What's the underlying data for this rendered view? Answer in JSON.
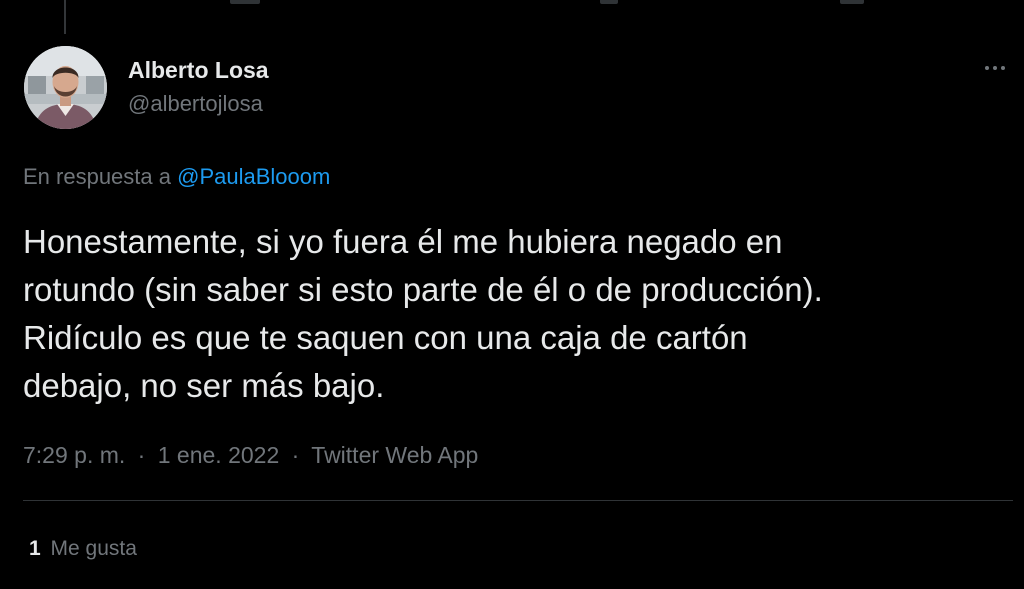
{
  "colors": {
    "background": "#000000",
    "primary_text": "#e7e9ea",
    "secondary_text": "#71767b",
    "link": "#1d9bf0",
    "divider": "#2f3336"
  },
  "tweet": {
    "author": {
      "display_name": "Alberto Losa",
      "handle": "@albertojlosa",
      "avatar_icon": "user-avatar-photo"
    },
    "more_icon": "more-horizontal-icon",
    "reply_context": {
      "prefix": "En respuesta a",
      "mention": "@PaulaBlooom"
    },
    "text": "Honestamente, si yo fuera él me hubiera negado en\nrotundo (sin saber si esto parte de él o de producción).\nRidículo es que te saquen con una caja de cartón\ndebajo, no ser más bajo.",
    "time": "7:29 p. m.",
    "separator": "·",
    "date": "1 ene. 2022",
    "source": "Twitter Web App",
    "stats": {
      "likes_count": "1",
      "likes_label": "Me gusta"
    }
  }
}
